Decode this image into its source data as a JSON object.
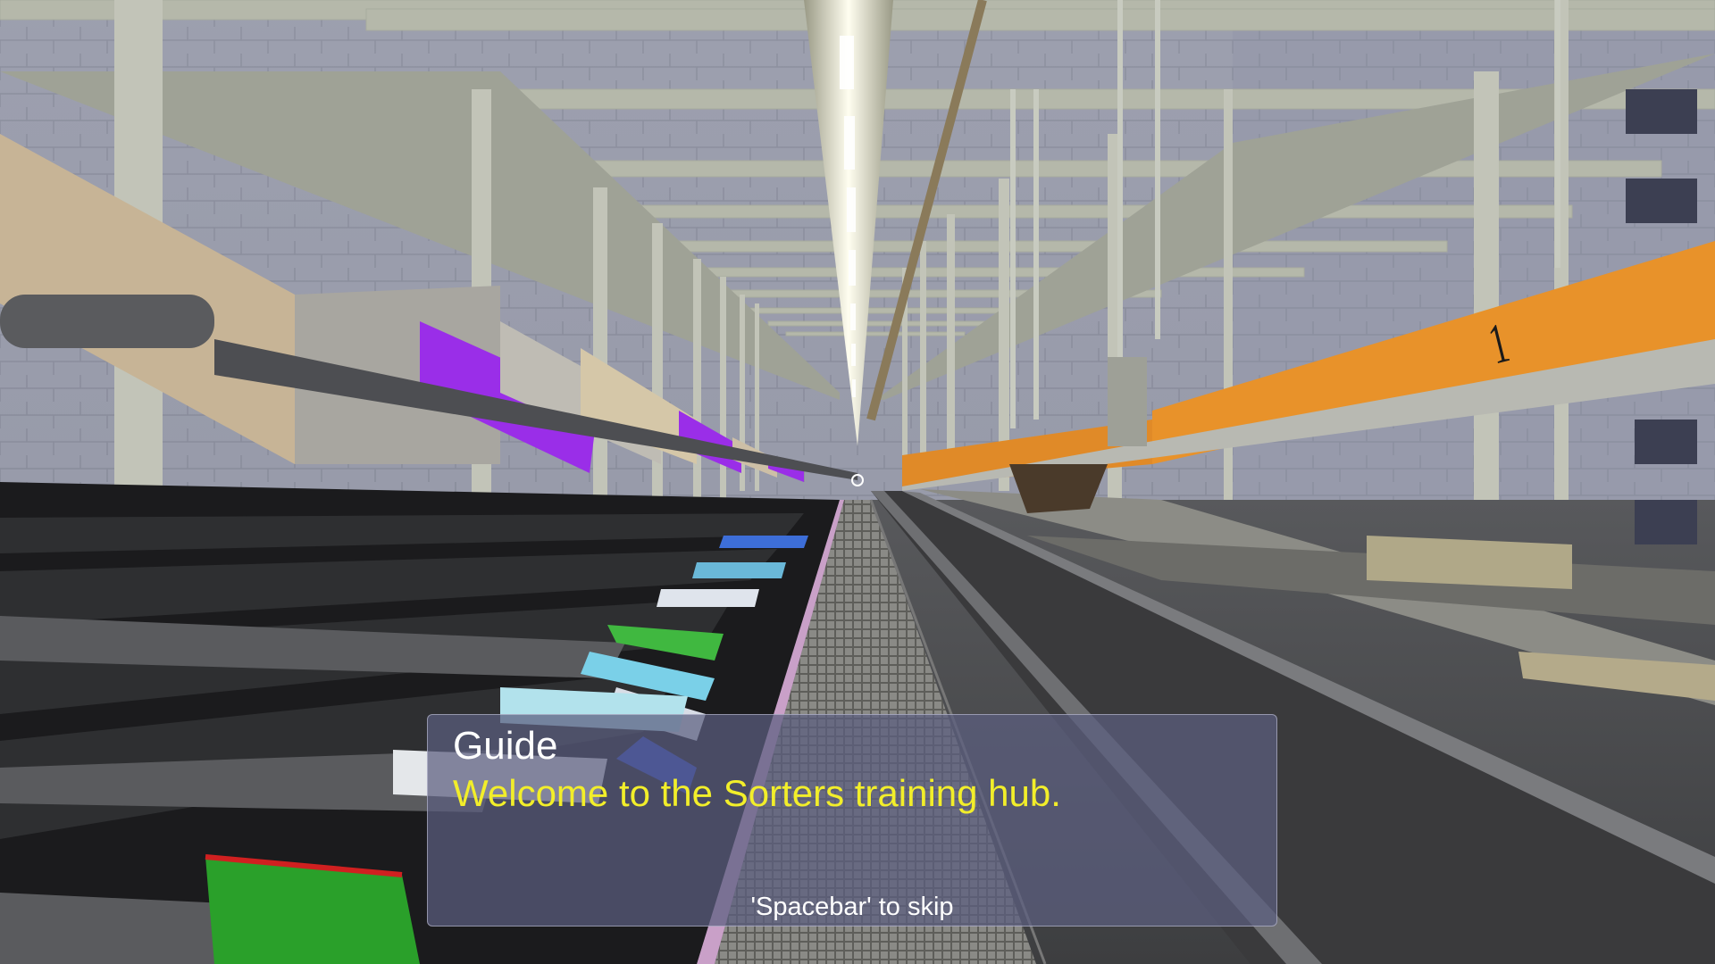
{
  "scene": {
    "rail_number": "1"
  },
  "dialog": {
    "speaker": "Guide",
    "message": "Welcome to the Sorters training hub.",
    "skip_hint": "'Spacebar' to skip"
  },
  "colors": {
    "dialog_text": "#f2ee2a",
    "speaker_text": "#ffffff",
    "rail_orange": "#e8922a"
  }
}
